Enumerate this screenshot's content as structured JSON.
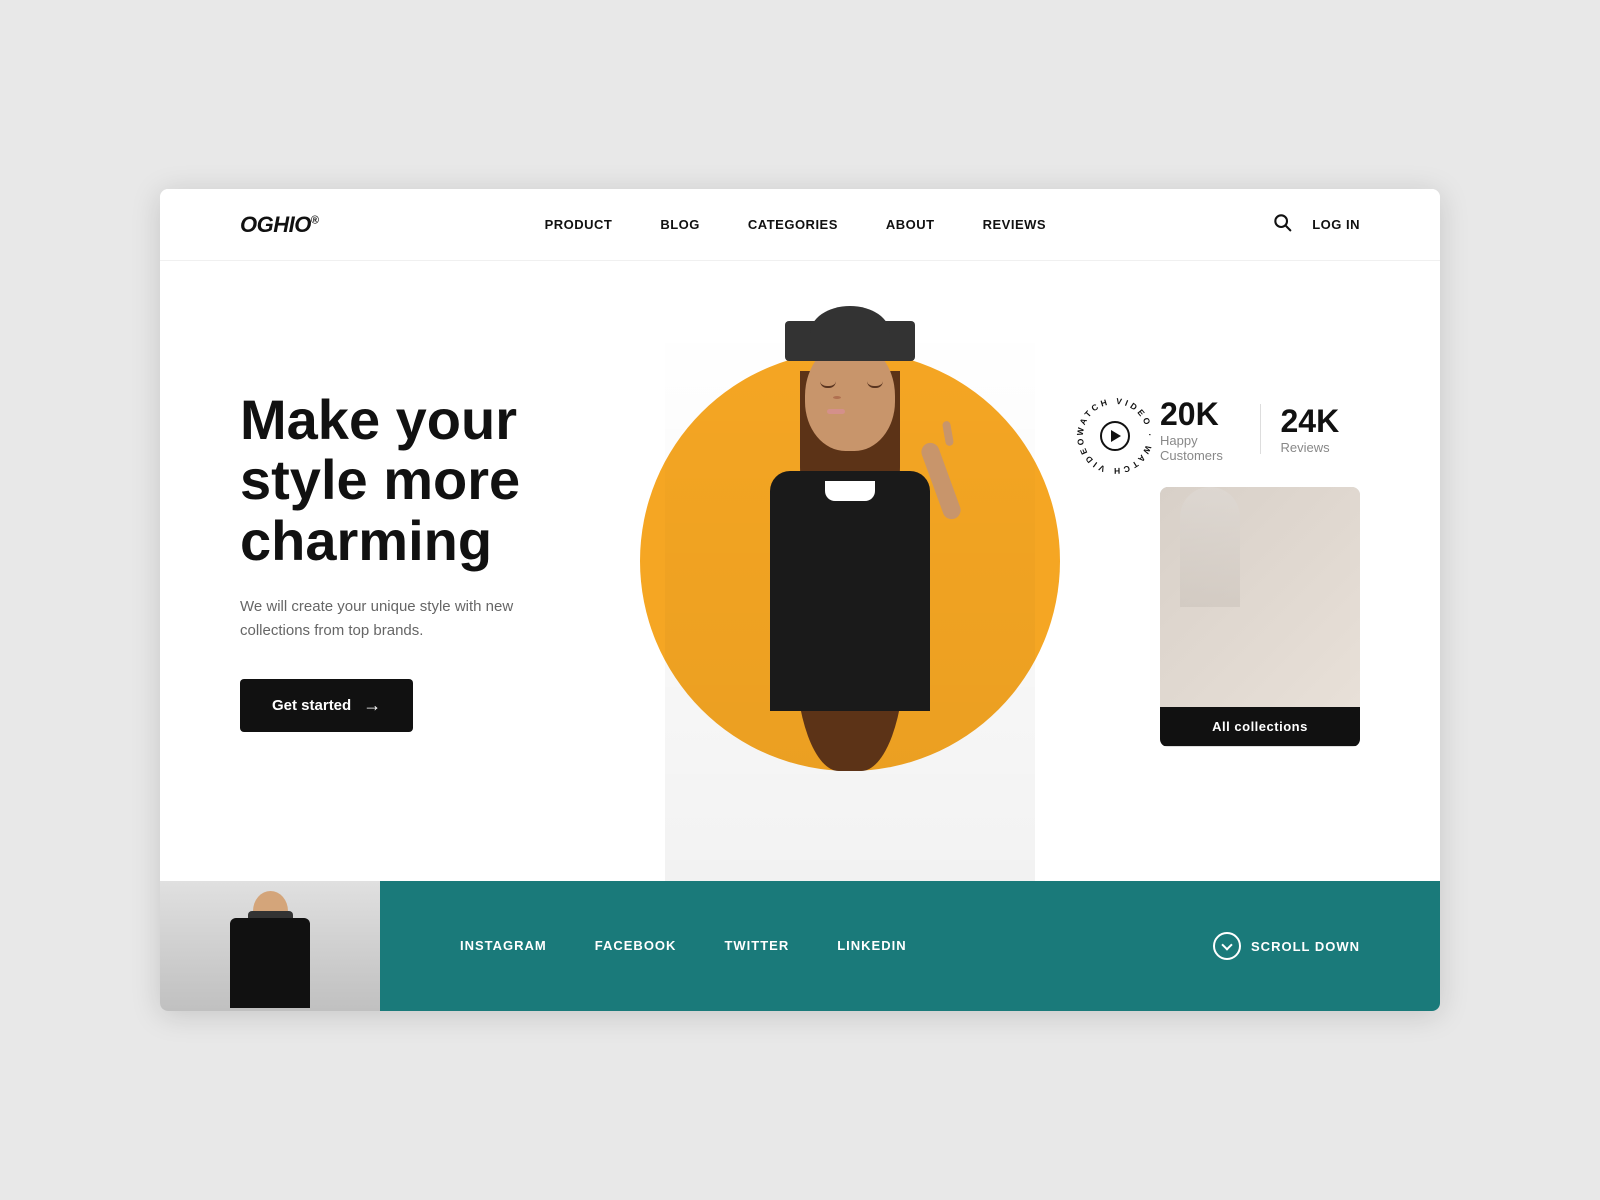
{
  "brand": {
    "name": "OGHIO",
    "trademark": "®"
  },
  "nav": {
    "links": [
      {
        "label": "PRODUCT",
        "href": "#"
      },
      {
        "label": "BLOG",
        "href": "#"
      },
      {
        "label": "CATEGORIES",
        "href": "#"
      },
      {
        "label": "ABOUT",
        "href": "#"
      },
      {
        "label": "REVIEWS",
        "href": "#"
      }
    ],
    "login_label": "LOG IN"
  },
  "hero": {
    "headline": "Make your style more charming",
    "subtext": "We will create your unique style\nwith new collections from top brands.",
    "cta_label": "Get started",
    "watch_video_text": "WATCH VIDEO",
    "stat1_num": "20K",
    "stat1_label": "Happy Customers",
    "stat2_num": "24K",
    "stat2_label": "Reviews",
    "collection_label": "All collections"
  },
  "footer": {
    "social_links": [
      {
        "label": "INSTAGRAM",
        "href": "#"
      },
      {
        "label": "FACEBOOK",
        "href": "#"
      },
      {
        "label": "TWITTER",
        "href": "#"
      },
      {
        "label": "LINKEDIN",
        "href": "#"
      }
    ],
    "scroll_label": "SCROLL DOWN"
  },
  "colors": {
    "accent_yellow": "#F5A623",
    "accent_teal": "#1a7a7a",
    "dark": "#111111",
    "white": "#ffffff"
  }
}
